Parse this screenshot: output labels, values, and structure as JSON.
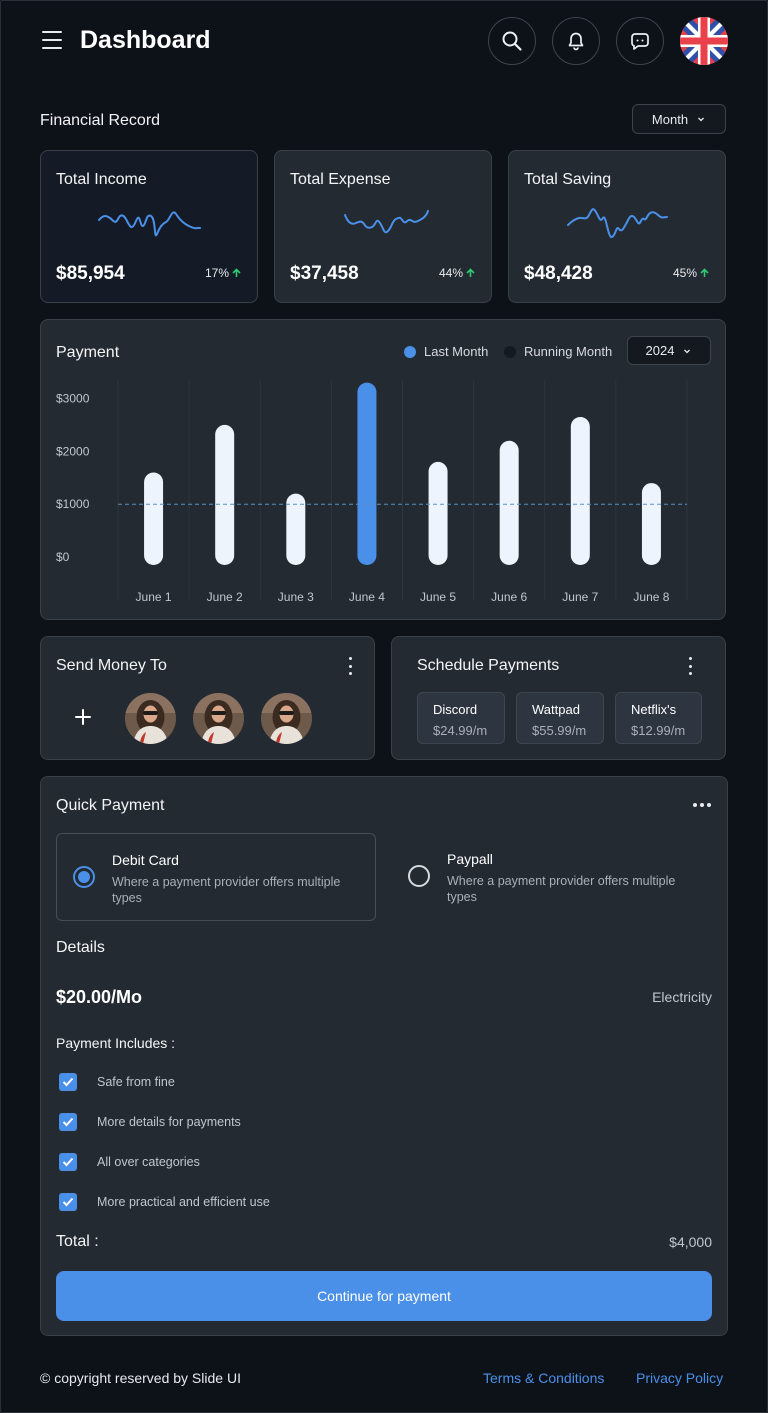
{
  "header": {
    "title": "Dashboard",
    "icons": [
      "menu-icon",
      "search-icon",
      "bell-icon",
      "chat-icon",
      "uk-flag-icon"
    ]
  },
  "financial_record": {
    "label": "Financial Record",
    "period": "Month",
    "cards": [
      {
        "title": "Total Income",
        "value": "$85,954",
        "change": "17%",
        "trend": "up"
      },
      {
        "title": "Total Expense",
        "value": "$37,458",
        "change": "44%",
        "trend": "up"
      },
      {
        "title": "Total Saving",
        "value": "$48,428",
        "change": "45%",
        "trend": "up"
      }
    ]
  },
  "payment": {
    "title": "Payment",
    "year": "2024",
    "legend": [
      {
        "label": "Last Month",
        "color": "#4a90e8"
      },
      {
        "label": "Running Month",
        "color": "#1c2330"
      }
    ]
  },
  "chart_data": {
    "type": "bar",
    "categories": [
      "June 1",
      "June 2",
      "June 3",
      "June 4",
      "June 5",
      "June 6",
      "June 7",
      "June 8"
    ],
    "values": [
      1600,
      2500,
      1200,
      3300,
      1800,
      2200,
      2650,
      1400
    ],
    "highlight_index": 3,
    "y_ticks": [
      "$3000",
      "$2000",
      "$1000",
      "$0"
    ],
    "reference_line": 1000,
    "ylim": [
      -150,
      3350
    ],
    "colors": {
      "bar": "#eef4fd",
      "highlight": "#4a90e8",
      "reference": "#5a8fc8"
    }
  },
  "send_money": {
    "title": "Send Money To",
    "recipients": 3
  },
  "schedule": {
    "title": "Schedule Payments",
    "items": [
      {
        "name": "Discord",
        "price": "$24.99/m"
      },
      {
        "name": "Wattpad",
        "price": "$55.99/m"
      },
      {
        "name": "Netflix's",
        "price": "$12.99/m"
      }
    ]
  },
  "quick_payment": {
    "title": "Quick Payment",
    "options": [
      {
        "title": "Debit Card",
        "desc": "Where a payment provider offers multiple types",
        "selected": true
      },
      {
        "title": "Paypall",
        "desc": "Where a payment provider offers multiple types",
        "selected": false
      }
    ],
    "details_title": "Details",
    "price": "$20.00/Mo",
    "category": "Electricity",
    "includes_title": "Payment Includes :",
    "includes": [
      "Safe from fine",
      "More details for payments",
      "All over categories",
      "More practical and efficient use"
    ],
    "total_label": "Total :",
    "total_value": "$4,000",
    "cta": "Continue for payment"
  },
  "footer": {
    "copyright": "© copyright reserved by Slide UI",
    "links": [
      "Terms & Conditions",
      "Privacy Policy"
    ]
  },
  "colors": {
    "background": "#0d1118",
    "card": "#232a31",
    "accent": "#4a90e8",
    "positive": "#2ecc71"
  }
}
